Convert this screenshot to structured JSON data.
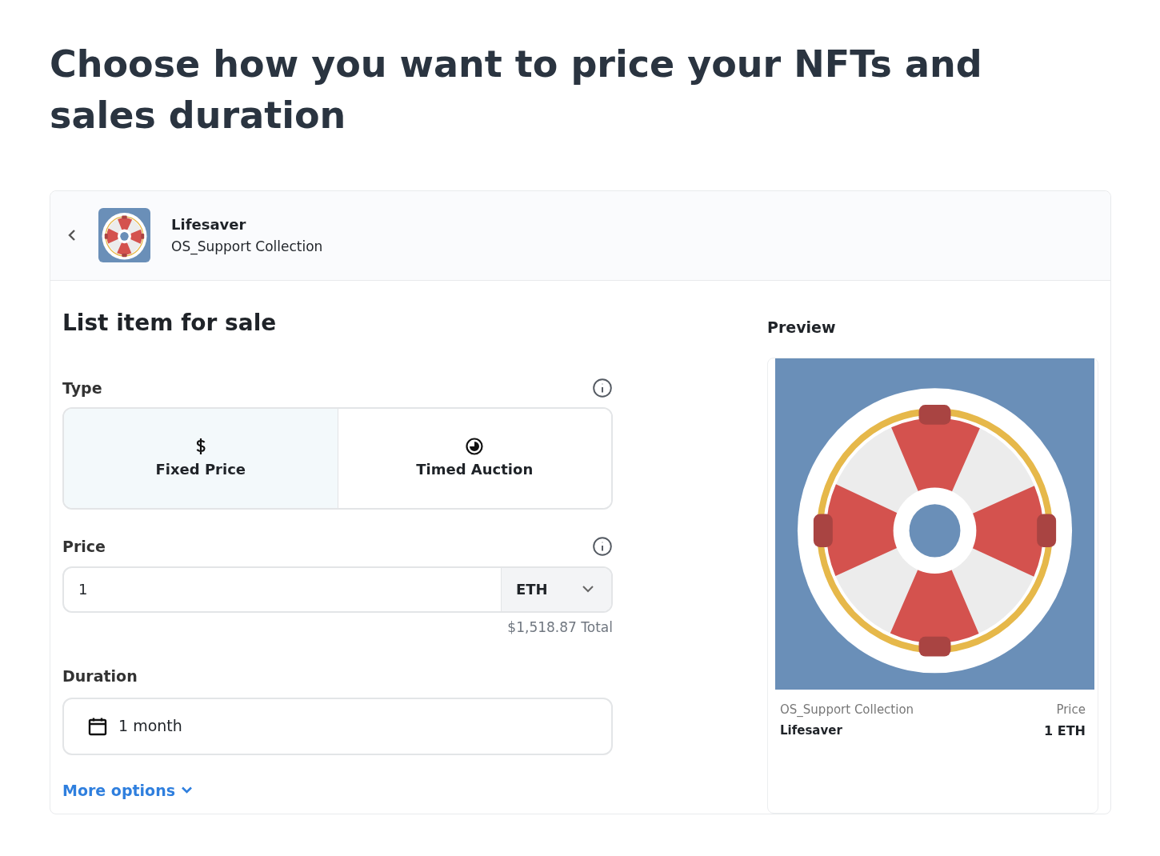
{
  "page_title": "Choose how you want to price your NFTs and sales duration",
  "item_header": {
    "name": "Lifesaver",
    "collection": "OS_Support Collection"
  },
  "form": {
    "title": "List item for sale",
    "type": {
      "label": "Type",
      "options": [
        {
          "label": "Fixed Price",
          "kind": "dollar",
          "selected": true
        },
        {
          "label": "Timed Auction",
          "kind": "clock",
          "selected": false
        }
      ]
    },
    "price": {
      "label": "Price",
      "value": "1",
      "currency": "ETH",
      "total": "$1,518.87 Total"
    },
    "duration": {
      "label": "Duration",
      "value": "1 month"
    },
    "more_options": "More options"
  },
  "preview": {
    "title": "Preview",
    "collection": "OS_Support Collection",
    "name": "Lifesaver",
    "price_label": "Price",
    "price": "1 ETH"
  }
}
